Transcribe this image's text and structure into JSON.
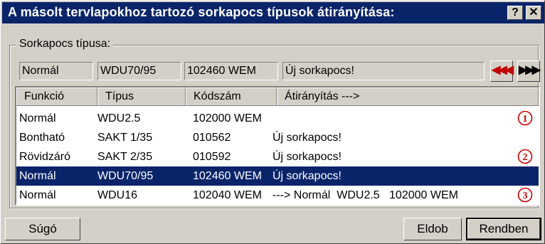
{
  "window": {
    "title": "A másolt tervlapokhoz tartozó sorkapocs típusok átirányítása:",
    "help_glyph": "?",
    "close_glyph": "✕"
  },
  "group": {
    "label": "Sorkapocs típusa:",
    "current": {
      "funkcio": "Normál",
      "tipus": "WDU70/95",
      "kodszam": "102460 WEM",
      "atiranyitas": "Új sorkapocs!"
    },
    "prev_glyph": "◀◀◀",
    "next_glyph": "▶▶▶"
  },
  "table": {
    "columns": [
      "Funkció",
      "Típus",
      "Kódszám",
      "Átirányítás --->"
    ],
    "rows": [
      {
        "funkcio": "Normál",
        "tipus": "WDU2.5",
        "kodszam": "102000 WEM",
        "atiranyitas": "",
        "marker": "1"
      },
      {
        "funkcio": "Bontható",
        "tipus": "SAKT 1/35",
        "kodszam": "010562",
        "atiranyitas": "Új sorkapocs!",
        "marker": ""
      },
      {
        "funkcio": "Rövidzáró",
        "tipus": "SAKT 2/35",
        "kodszam": "010592",
        "atiranyitas": "Új sorkapocs!",
        "marker": "2"
      },
      {
        "funkcio": "Normál",
        "tipus": "WDU70/95",
        "kodszam": "102460 WEM",
        "atiranyitas": "Új sorkapocs!",
        "marker": "",
        "selected": true
      },
      {
        "funkcio": "Normál",
        "tipus": "WDU16",
        "kodszam": "102040 WEM",
        "atiranyitas": "---> Normál  WDU2.5   102000 WEM",
        "marker": "3"
      }
    ]
  },
  "buttons": {
    "help": "Súgó",
    "cancel": "Eldob",
    "ok": "Rendben"
  },
  "colors": {
    "titlebar": "#0a246a",
    "selection": "#0a246a",
    "nav_arrow": "#c00000",
    "marker": "#d00000"
  }
}
